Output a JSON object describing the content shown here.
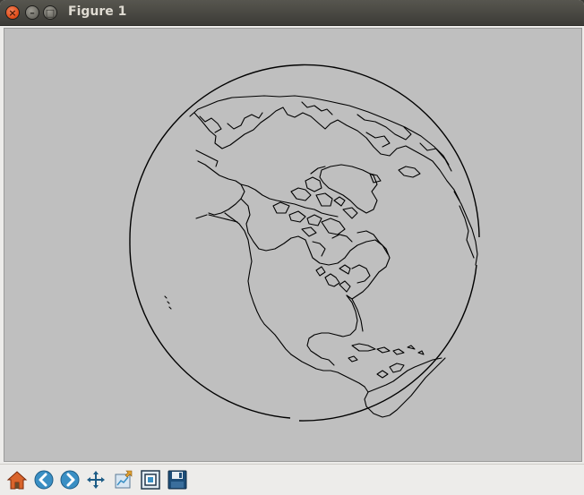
{
  "window": {
    "title": "Figure 1"
  },
  "toolbar": {
    "tools": [
      {
        "icon": "home-icon"
      },
      {
        "icon": "back-icon"
      },
      {
        "icon": "forward-icon"
      },
      {
        "icon": "pan-icon"
      },
      {
        "icon": "configure-subplots-icon"
      },
      {
        "icon": "zoom-rect-icon"
      },
      {
        "icon": "save-icon"
      }
    ]
  },
  "colors": {
    "canvas": "#bfbfbf",
    "coastline": "#000000",
    "titlebar": "#3c3b37"
  }
}
